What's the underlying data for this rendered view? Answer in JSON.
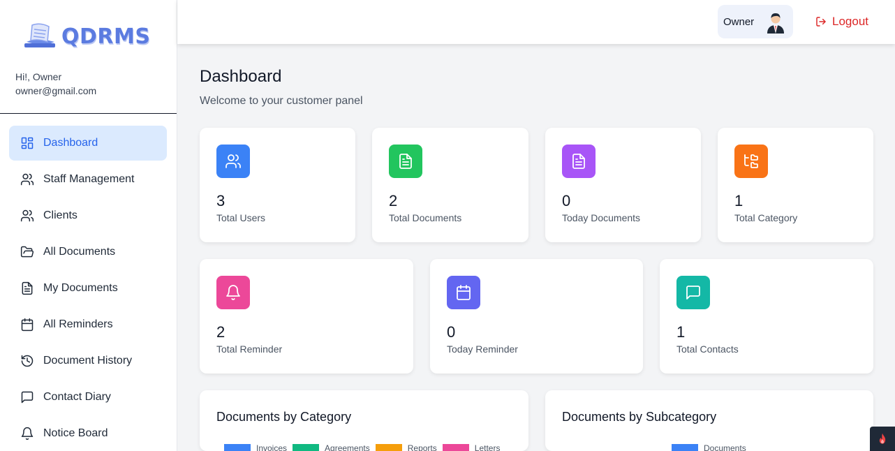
{
  "brand": {
    "name": "QDRMS"
  },
  "sidebar": {
    "greeting": "Hi!, Owner",
    "email": "owner@gmail.com",
    "items": [
      {
        "label": "Dashboard",
        "icon": "dashboard-icon",
        "active": true
      },
      {
        "label": "Staff Management",
        "icon": "users-icon"
      },
      {
        "label": "Clients",
        "icon": "users-icon"
      },
      {
        "label": "All Documents",
        "icon": "folder-open-icon"
      },
      {
        "label": "My Documents",
        "icon": "file-text-icon"
      },
      {
        "label": "All Reminders",
        "icon": "calendar-icon"
      },
      {
        "label": "Document History",
        "icon": "history-icon"
      },
      {
        "label": "Contact Diary",
        "icon": "message-square-icon"
      },
      {
        "label": "Notice Board",
        "icon": "bell-icon"
      }
    ]
  },
  "topbar": {
    "user_name": "Owner",
    "logout_label": "Logout"
  },
  "page": {
    "title": "Dashboard",
    "subtitle": "Welcome to your customer panel"
  },
  "stats": [
    {
      "value": "3",
      "label": "Total Users",
      "color": "#3b82f6",
      "icon": "users-icon"
    },
    {
      "value": "2",
      "label": "Total Documents",
      "color": "#22c55e",
      "icon": "file-text-icon"
    },
    {
      "value": "0",
      "label": "Today Documents",
      "color": "#a855f7",
      "icon": "file-text-icon"
    },
    {
      "value": "1",
      "label": "Total Category",
      "color": "#f97316",
      "icon": "folder-tree-icon"
    },
    {
      "value": "2",
      "label": "Total Reminder",
      "color": "#ec4899",
      "icon": "bell-icon"
    },
    {
      "value": "0",
      "label": "Today Reminder",
      "color": "#6366f1",
      "icon": "calendar-icon"
    },
    {
      "value": "1",
      "label": "Total Contacts",
      "color": "#14b8a6",
      "icon": "message-square-icon"
    }
  ],
  "charts": {
    "category": {
      "title": "Documents by Category",
      "legend": [
        {
          "label": "Invoices",
          "color": "#3b82f6"
        },
        {
          "label": "Agreements",
          "color": "#10b981"
        },
        {
          "label": "Reports",
          "color": "#f59e0b"
        },
        {
          "label": "Letters",
          "color": "#ec4899"
        }
      ]
    },
    "subcategory": {
      "title": "Documents by Subcategory",
      "legend": [
        {
          "label": "Documents",
          "color": "#3b82f6"
        }
      ]
    }
  }
}
